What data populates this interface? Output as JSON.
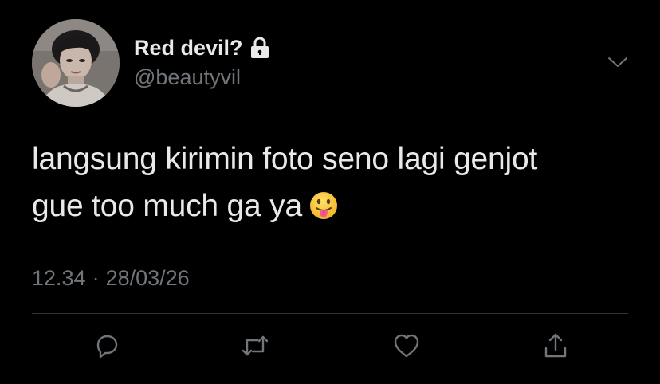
{
  "user": {
    "display_name": "Red devil?",
    "handle": "@beautyvil",
    "protected": true
  },
  "tweet": {
    "lines": [
      "langsung kirimin foto seno lagi genjot",
      "gue too much ga ya"
    ],
    "emoji": "face-with-tongue"
  },
  "meta": {
    "time": "12.34",
    "separator": "·",
    "date": "28/03/26"
  },
  "actions": {
    "items": [
      "reply",
      "retweet",
      "like",
      "share"
    ]
  },
  "colors": {
    "background": "#000000",
    "text_primary": "#e7e9ea",
    "text_secondary": "#71767b",
    "divider": "#2f3336"
  }
}
